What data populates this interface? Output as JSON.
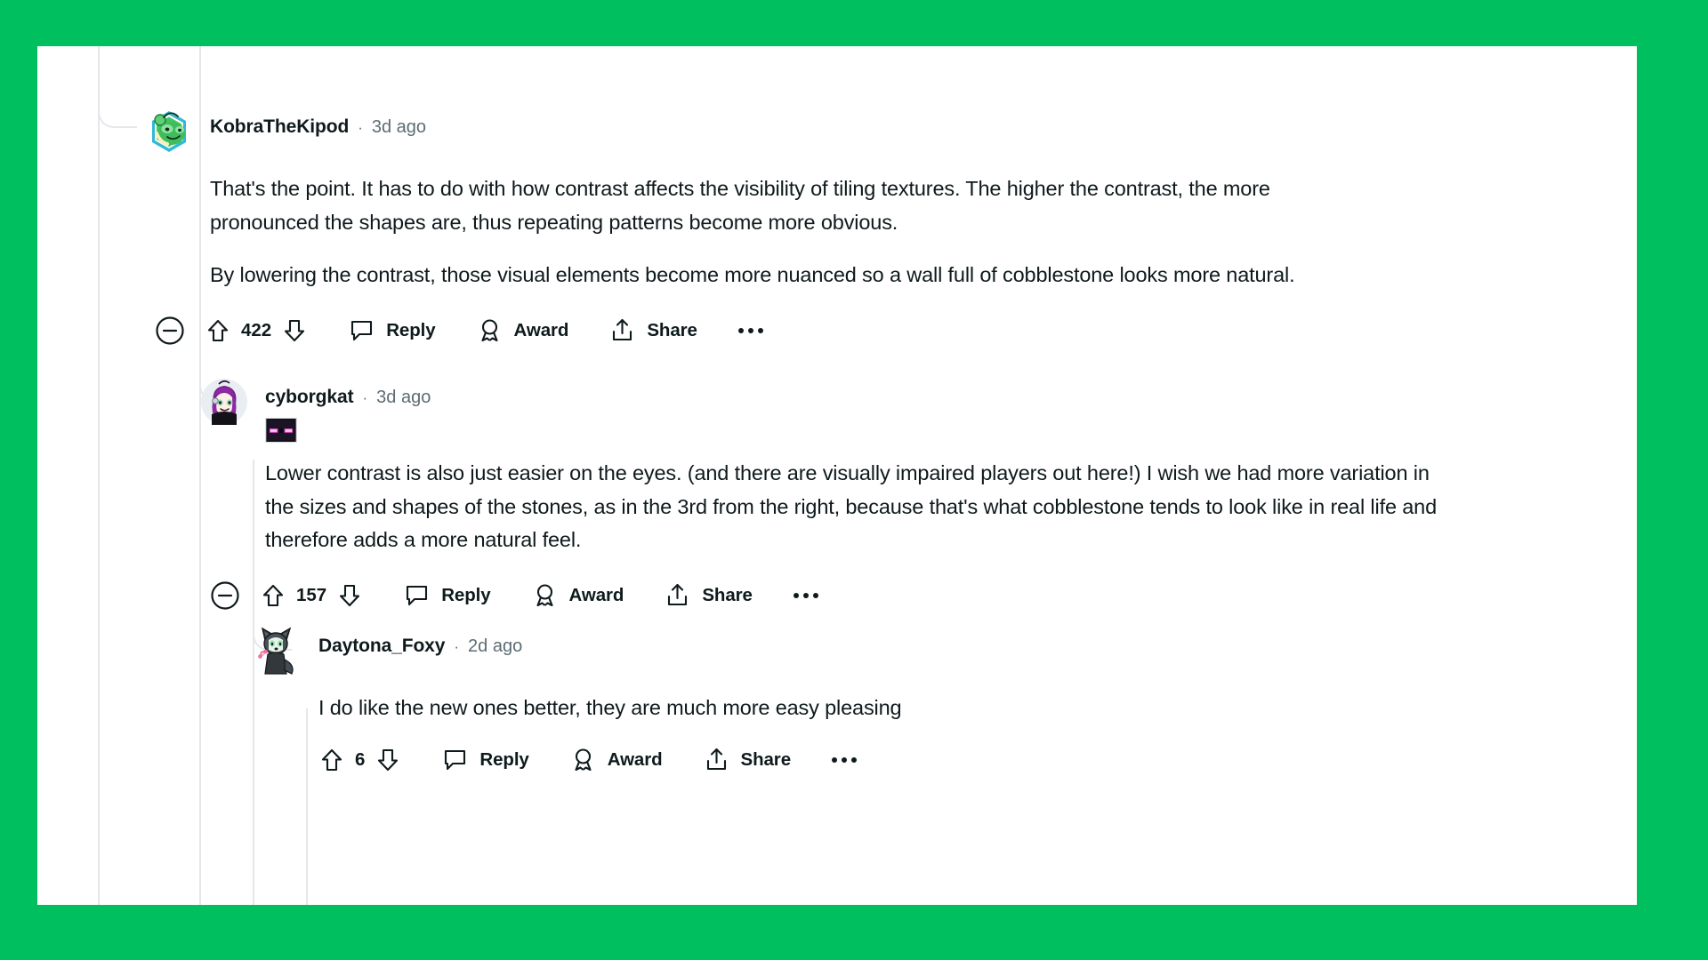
{
  "theme": {
    "page_background": "#00bf5f",
    "card_background": "#ffffff",
    "text_primary": "#0f1a1c",
    "text_muted": "#5c6c74",
    "thread_line": "#e5e7ea"
  },
  "comments": [
    {
      "id": "comment-0",
      "username": "KobraTheKipod",
      "separator": "·",
      "timestamp": "3d ago",
      "avatar_icon": "frog-avatar",
      "has_flair": false,
      "paragraphs": [
        "That's the point. It has to do with how contrast affects the visibility of tiling textures. The higher the contrast, the more pronounced the shapes are, thus repeating patterns become more obvious.",
        "By lowering the contrast, those visual elements become more nuanced so a wall full of cobblestone looks more natural."
      ],
      "actions": {
        "has_collapse": true,
        "collapse_icon": "minus-circle-icon",
        "upvote_icon": "upvote-arrow-icon",
        "vote_count": "422",
        "downvote_icon": "downvote-arrow-icon",
        "reply_icon": "speech-bubble-icon",
        "reply_label": "Reply",
        "award_icon": "award-ribbon-icon",
        "award_label": "Award",
        "share_icon": "share-upload-icon",
        "share_label": "Share",
        "overflow_icon": "more-options-icon"
      }
    },
    {
      "id": "comment-1",
      "username": "cyborgkat",
      "separator": "·",
      "timestamp": "3d ago",
      "avatar_icon": "purple-hair-avatar",
      "has_flair": true,
      "flair_icon": "enderman-face-flair",
      "paragraphs": [
        "Lower contrast is also just easier on the eyes. (and there are visually impaired players out here!) I wish we had more variation in the sizes and shapes of the stones, as in the 3rd from the right, because that's what cobblestone tends to look like in real life and therefore adds a more natural feel."
      ],
      "actions": {
        "has_collapse": true,
        "collapse_icon": "minus-circle-icon",
        "upvote_icon": "upvote-arrow-icon",
        "vote_count": "157",
        "downvote_icon": "downvote-arrow-icon",
        "reply_icon": "speech-bubble-icon",
        "reply_label": "Reply",
        "award_icon": "award-ribbon-icon",
        "award_label": "Award",
        "share_icon": "share-upload-icon",
        "share_label": "Share",
        "overflow_icon": "more-options-icon"
      }
    },
    {
      "id": "comment-2",
      "username": "Daytona_Foxy",
      "separator": "·",
      "timestamp": "2d ago",
      "avatar_icon": "wolf-avatar",
      "has_flair": false,
      "paragraphs": [
        "I do like the new ones better, they are much more easy pleasing"
      ],
      "actions": {
        "has_collapse": false,
        "upvote_icon": "upvote-arrow-icon",
        "vote_count": "6",
        "downvote_icon": "downvote-arrow-icon",
        "reply_icon": "speech-bubble-icon",
        "reply_label": "Reply",
        "award_icon": "award-ribbon-icon",
        "award_label": "Award",
        "share_icon": "share-upload-icon",
        "share_label": "Share",
        "overflow_icon": "more-options-icon"
      }
    }
  ]
}
